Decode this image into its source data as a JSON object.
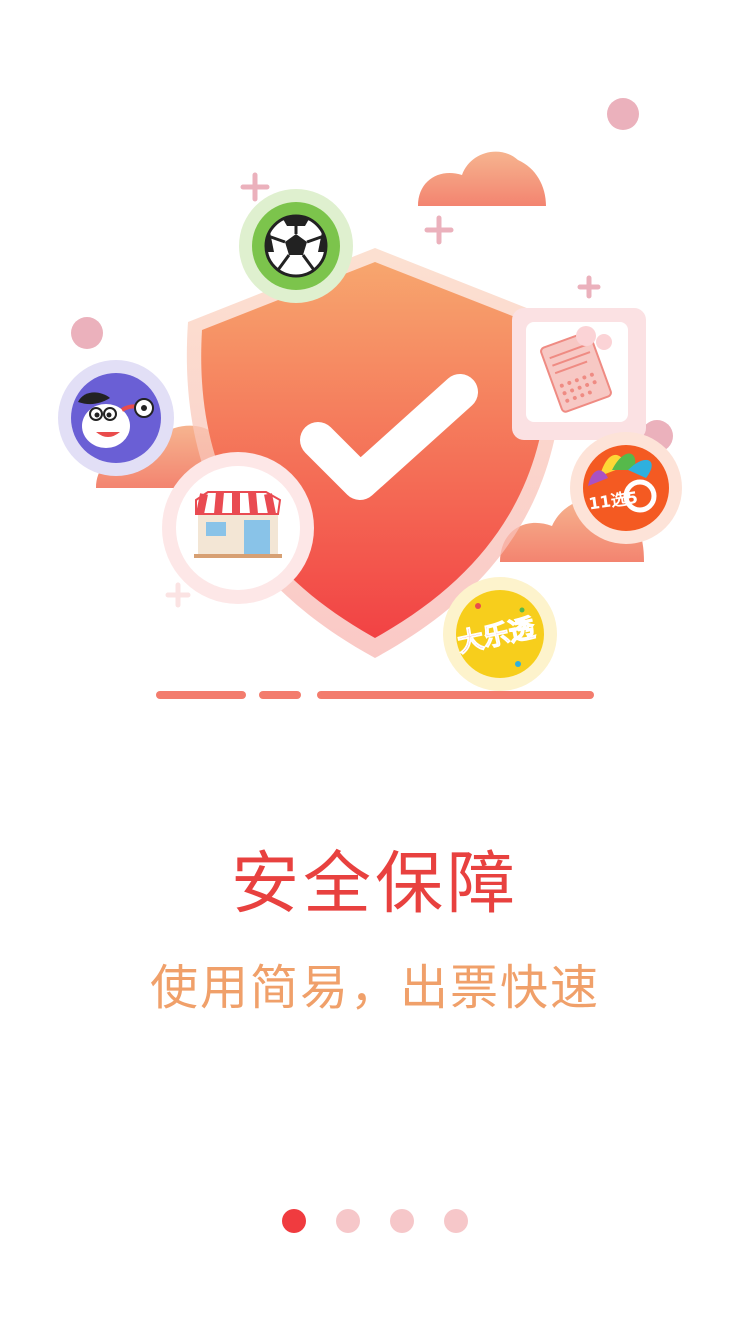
{
  "onboarding": {
    "title": "安全保障",
    "subtitle": "使用简易，出票快速",
    "current_page": 1,
    "page_count": 4
  },
  "illustration": {
    "badge_dlt": "大乐透",
    "badge_11x5": "11选5"
  },
  "icons": {
    "center": "shield-checkmark-icon",
    "top": "soccer-ball-icon",
    "left": "cartoon-dog-soccer-icon",
    "bottom_left": "store-icon",
    "right": "lottery-ticket-icon",
    "right_lower": "11-choose-5-icon",
    "bottom_right": "daletou-icon"
  },
  "colors": {
    "title": "#e8413f",
    "subtitle": "#f0a06a",
    "shield_top": "#f6a06d",
    "shield_bottom": "#f24344",
    "dot_active": "#f03b3f",
    "dot_inactive": "#f6c7c9",
    "decor_pink": "#ebb1bc",
    "cloud": "#f39c80",
    "ground_line": "#f37c6d"
  }
}
